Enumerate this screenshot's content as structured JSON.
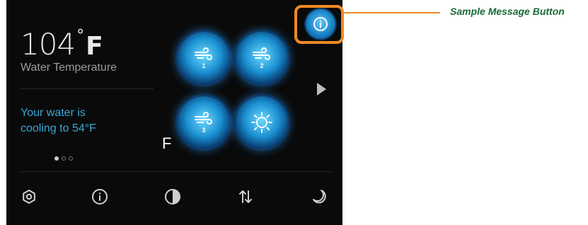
{
  "panel": {
    "temperature": {
      "value": "104",
      "degree": "°",
      "unit": "F"
    },
    "temperature_label": "Water Temperature",
    "status": {
      "line1": "Your water is",
      "line2": "cooling to 54°F"
    },
    "page_dots": 3,
    "active_page": 1,
    "stray_label": "F",
    "fan_buttons": [
      {
        "label": "1",
        "icon": "wind-icon"
      },
      {
        "label": "2",
        "icon": "wind-icon"
      },
      {
        "label": "3",
        "icon": "wind-icon"
      },
      {
        "label": "",
        "icon": "sun-icon"
      }
    ],
    "bottom_bar": [
      "gear-icon",
      "info-icon",
      "contrast-icon",
      "sort-arrows-icon",
      "moon-icon"
    ]
  },
  "annotation": {
    "label": "Sample Message Button"
  },
  "colors": {
    "accent": "#38a8d8",
    "highlight": "#f08a24",
    "label": "#1a6a3a"
  }
}
